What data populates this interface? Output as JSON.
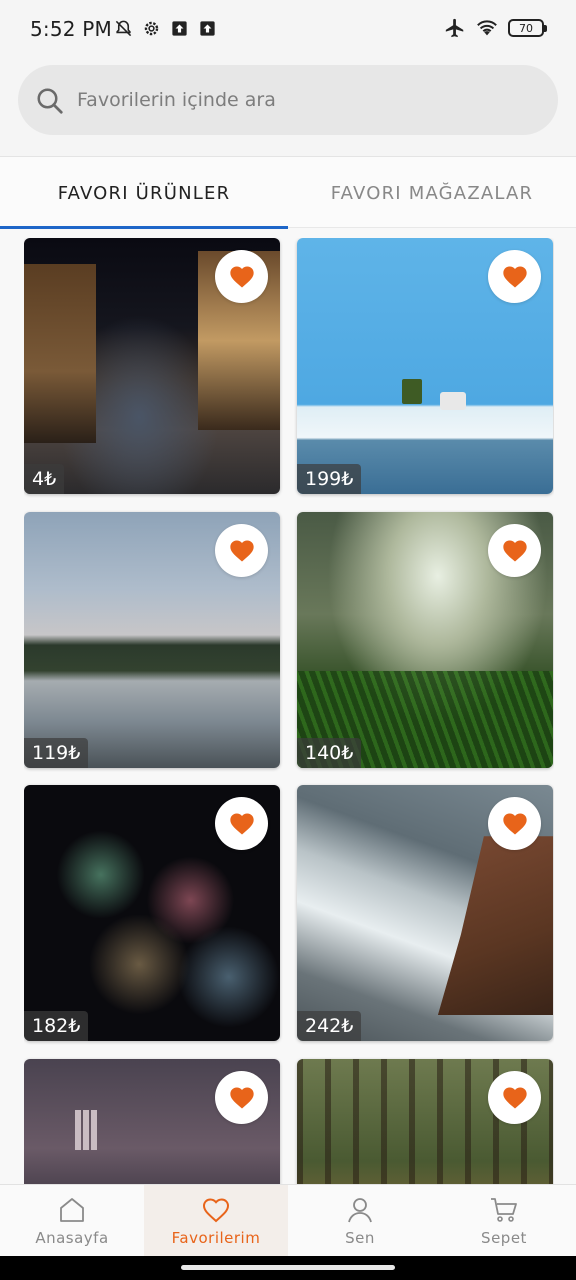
{
  "status_bar": {
    "time": "5:52 PM",
    "icons_left": [
      "notifications-off-icon",
      "settings-icon",
      "upload-icon",
      "upload-icon"
    ],
    "icons_right": [
      "airplane-icon",
      "wifi-icon",
      "battery-icon"
    ],
    "battery_level": "70"
  },
  "search": {
    "placeholder": "Favorilerin içinde ara",
    "value": ""
  },
  "tabs": [
    {
      "label": "FAVORI ÜRÜNLER",
      "active": true
    },
    {
      "label": "FAVORI MAĞAZALAR",
      "active": false
    }
  ],
  "products": [
    {
      "price": "4₺",
      "favorited": true,
      "image": "night-street-photo"
    },
    {
      "price": "199₺",
      "favorited": true,
      "image": "plant-on-table-photo"
    },
    {
      "price": "119₺",
      "favorited": true,
      "image": "misty-lake-photo"
    },
    {
      "price": "140₺",
      "favorited": true,
      "image": "grass-closeup-photo"
    },
    {
      "price": "182₺",
      "favorited": true,
      "image": "fireworks-photo"
    },
    {
      "price": "242₺",
      "favorited": true,
      "image": "ocean-wave-rock-photo"
    },
    {
      "price": "",
      "favorited": true,
      "image": "city-night-skyline-photo"
    },
    {
      "price": "",
      "favorited": true,
      "image": "forest-tulips-photo"
    }
  ],
  "bottom_nav": [
    {
      "label": "Anasayfa",
      "icon": "home-icon",
      "active": false
    },
    {
      "label": "Favorilerim",
      "icon": "heart-icon",
      "active": true
    },
    {
      "label": "Sen",
      "icon": "person-icon",
      "active": false
    },
    {
      "label": "Sepet",
      "icon": "cart-icon",
      "active": false
    }
  ],
  "colors": {
    "accent": "#e8641a",
    "tab_indicator": "#1e66c8"
  }
}
